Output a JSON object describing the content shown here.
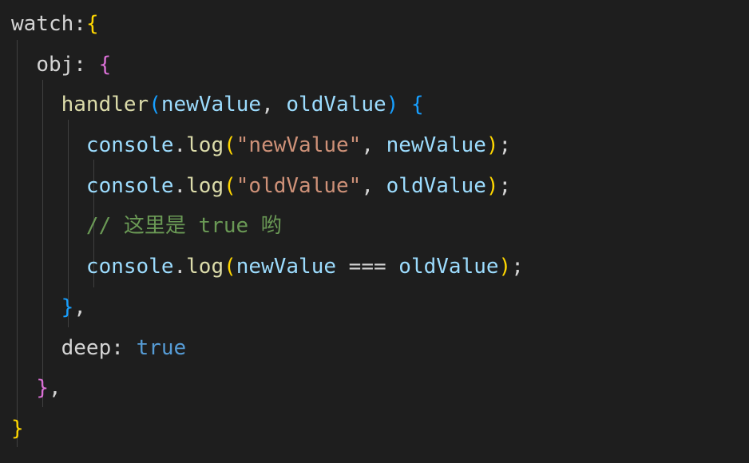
{
  "code": {
    "colors": {
      "background": "#1e1e1e",
      "default_text": "#d4d4d4",
      "function_name": "#dcdcaa",
      "variable": "#9cdcfe",
      "string": "#ce9178",
      "comment": "#6a9955",
      "keyword_literal": "#569cd6",
      "indent_guide": "#404040",
      "bracket_yellow": "#ffd700",
      "bracket_purple": "#da70d6",
      "bracket_blue": "#179fff"
    },
    "tokens": {
      "watch_key": "watch",
      "colon": ":",
      "obj_key": "obj",
      "handler_name": "handler",
      "param1": "newValue",
      "param2": "oldValue",
      "console_obj": "console",
      "log_method": "log",
      "string_newValue": "\"newValue\"",
      "string_oldValue": "\"oldValue\"",
      "comment_text": "// 这里是 true 哟",
      "strict_eq": "===",
      "deep_key": "deep",
      "true_literal": "true",
      "open_brace": "{",
      "close_brace": "}",
      "open_paren": "(",
      "close_paren": ")",
      "comma": ",",
      "semicolon": ";",
      "dot": "."
    }
  }
}
